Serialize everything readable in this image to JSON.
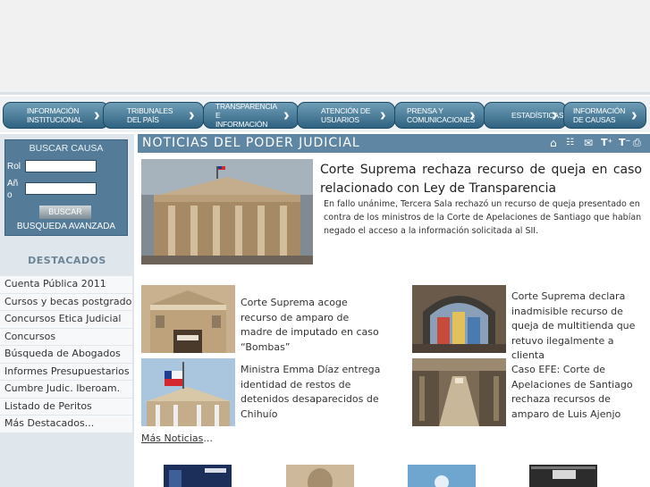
{
  "nav": {
    "items": [
      {
        "label": "INFORMACIÓN\nINSTITUCIONAL"
      },
      {
        "label": "TRIBUNALES\nDEL PAÍS"
      },
      {
        "label": "TRANSPARENCIA E\nINFORMACIÓN"
      },
      {
        "label": "ATENCIÓN DE\nUSUARIOS"
      },
      {
        "label": "PRENSA Y\nCOMUNICACIONES"
      },
      {
        "label": "ESTADÍSTICAS"
      },
      {
        "label": "INFORMACIÓN\nDE CAUSAS"
      }
    ]
  },
  "search": {
    "title": "BUSCAR CAUSA",
    "rol_label": "Rol",
    "anio_label": "Añ\no",
    "button": "BUSCAR",
    "advanced": "BUSQUEDA AVANZADA"
  },
  "destacados": {
    "title": "DESTACADOS",
    "items": [
      "Cuenta Pública 2011",
      "Cursos y becas postgrado",
      "Concursos Etica Judicial",
      "Concursos",
      "Búsqueda de Abogados",
      "Informes Presupuestarios",
      "Cumbre Judic. Iberoam.",
      "Listado de Peritos",
      "Más Destacados..."
    ]
  },
  "noticias": {
    "title": "NOTICIAS DEL PODER JUDICIAL",
    "toolbar_icons": [
      "home-icon",
      "sitemap-icon",
      "mail-icon",
      "text-increase-icon",
      "text-decrease-icon",
      "print-icon"
    ],
    "main": {
      "headline": "Corte Suprema rechaza recurso de queja en caso relacionado con Ley de Transparencia",
      "body": "En fallo unánime, Tercera Sala rechazó un recurso de queja presentado en contra de los ministros de la Corte de Apelaciones de Santiago que habían negado el acceso a la información solicitada al SII."
    },
    "items": [
      "Corte Suprema acoge recurso de amparo de madre de imputado en caso “Bombas”",
      "Corte Suprema declara inadmisible recurso de queja de multitienda que retuvo ilegalmente a clienta",
      "Ministra Emma Díaz entrega identidad de restos de detenidos desaparecidos de Chihuío",
      "Caso EFE: Corte de Apelaciones de Santiago rechaza recursos de amparo de Luis Ajenjo"
    ],
    "more_link": "Más Noticias",
    "more_suffix": "..."
  },
  "colors": {
    "nav_button": "#2f6381",
    "header_bar": "#5f87a4",
    "sidebar_bg": "#dfe7ec",
    "search_box": "#547b98"
  }
}
